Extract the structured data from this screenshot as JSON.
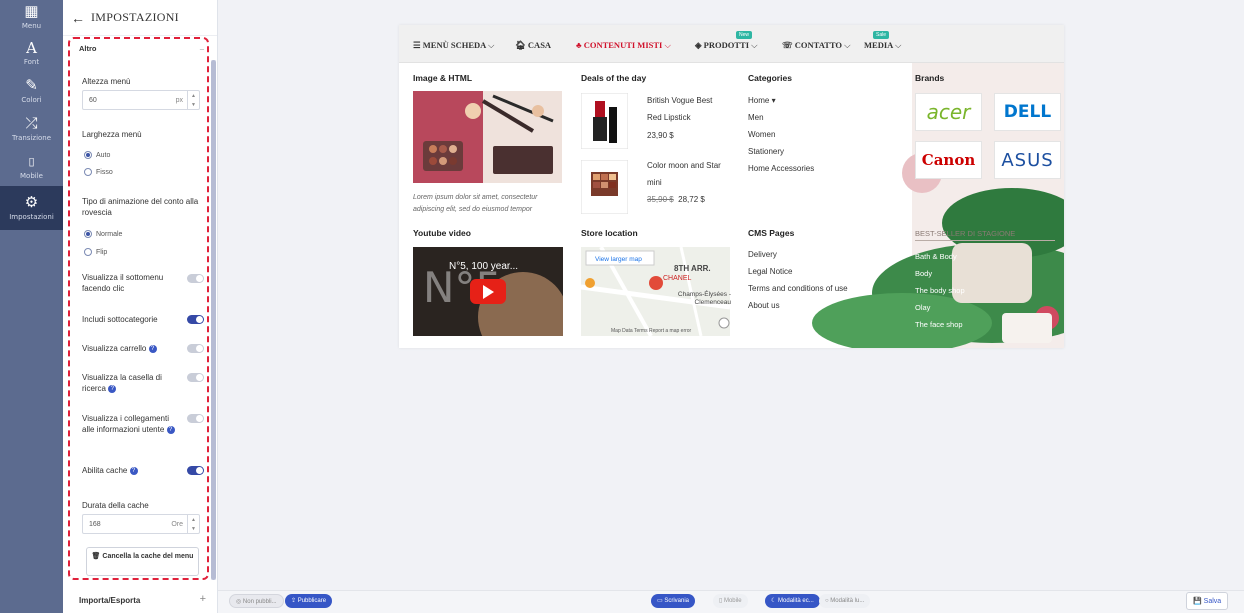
{
  "rail": [
    {
      "icon": "grid-icon",
      "label": "Menu"
    },
    {
      "icon": "font-icon",
      "label": "Font"
    },
    {
      "icon": "brush-icon",
      "label": "Colori"
    },
    {
      "icon": "shuffle-icon",
      "label": "Transizione"
    },
    {
      "icon": "mobile-icon",
      "label": "Mobile"
    },
    {
      "icon": "gear-icon",
      "label": "Impostazioni"
    }
  ],
  "panel": {
    "title": "IMPOSTAZIONI",
    "section": "Altro",
    "menu_height_label": "Altezza menù",
    "menu_height_value": "60",
    "menu_height_unit": "px",
    "menu_width_label": "Larghezza menù",
    "width_opt_auto": "Auto",
    "width_opt_fixed": "Fisso",
    "anim_label": "Tipo di animazione del conto alla rovescia",
    "anim_opt_normal": "Normale",
    "anim_opt_flip": "Flip",
    "submenu_click": "Visualizza il sottomenu facendo clic",
    "include_sub": "Includi sottocategorie",
    "show_cart": "Visualizza carrello",
    "show_search": "Visualizza la casella di ricerca",
    "show_user_links": "Visualizza i collegamenti alle informazioni utente",
    "enable_cache": "Abilita cache",
    "cache_duration_label": "Durata della cache",
    "cache_duration_value": "168",
    "cache_duration_unit": "Ore",
    "clear_cache": "Cancella la cache del menu",
    "import_export": "Importa/Esporta"
  },
  "bottombar": {
    "unpublished": "Non pubbli...",
    "publish": "Pubblicare",
    "desktop": "Scrivania",
    "mobile": "Mobile",
    "mode_ec": "Modalità ec...",
    "mode_lu": "Modalità lu...",
    "save": "Salva"
  },
  "menu": {
    "items": [
      "MENÙ SCHEDA",
      "CASA",
      "CONTENUTI MISTI",
      "PRODOTTI",
      "CONTATTO",
      "MEDIA"
    ],
    "badge_new": "New",
    "badge_sale": "Sale",
    "col1_title": "Image & HTML",
    "col1_text": "Lorem ipsum dolor sit amet, consectetur adipiscing elit, sed do eiusmod tempor",
    "col1_video_title": "Youtube video",
    "video_caption": "N°5, 100 year...",
    "col2_title": "Deals of the day",
    "deal1_name": "British Vogue Best Red Lipstick",
    "deal1_price": "23,90 $",
    "deal2_name": "Color moon and Star mini",
    "deal2_old": "35,90 $",
    "deal2_price": "28,72 $",
    "col2_store": "Store location",
    "map_link": "View larger map",
    "map_area": "8TH ARR.",
    "map_place": "CHANEL",
    "map_street": "Champs-Élysées - Clemenceau",
    "map_footer": "Map Data   Terms   Report a map error",
    "col3_title": "Categories",
    "categories": [
      "Home ▾",
      "Men",
      "Women",
      "Stationery",
      "Home Accessories"
    ],
    "col3_cms": "CMS Pages",
    "cms": [
      "Delivery",
      "Legal Notice",
      "Terms and conditions of use",
      "About us"
    ],
    "col4_title": "Brands",
    "brands": [
      "acer",
      "DELL",
      "Canon",
      "ASUS"
    ],
    "col4_sub": "BEST-SELLER DI STAGIONE",
    "col4_links": [
      "Bath & Body",
      "Body",
      "The body shop",
      "Olay",
      "The face shop"
    ]
  }
}
